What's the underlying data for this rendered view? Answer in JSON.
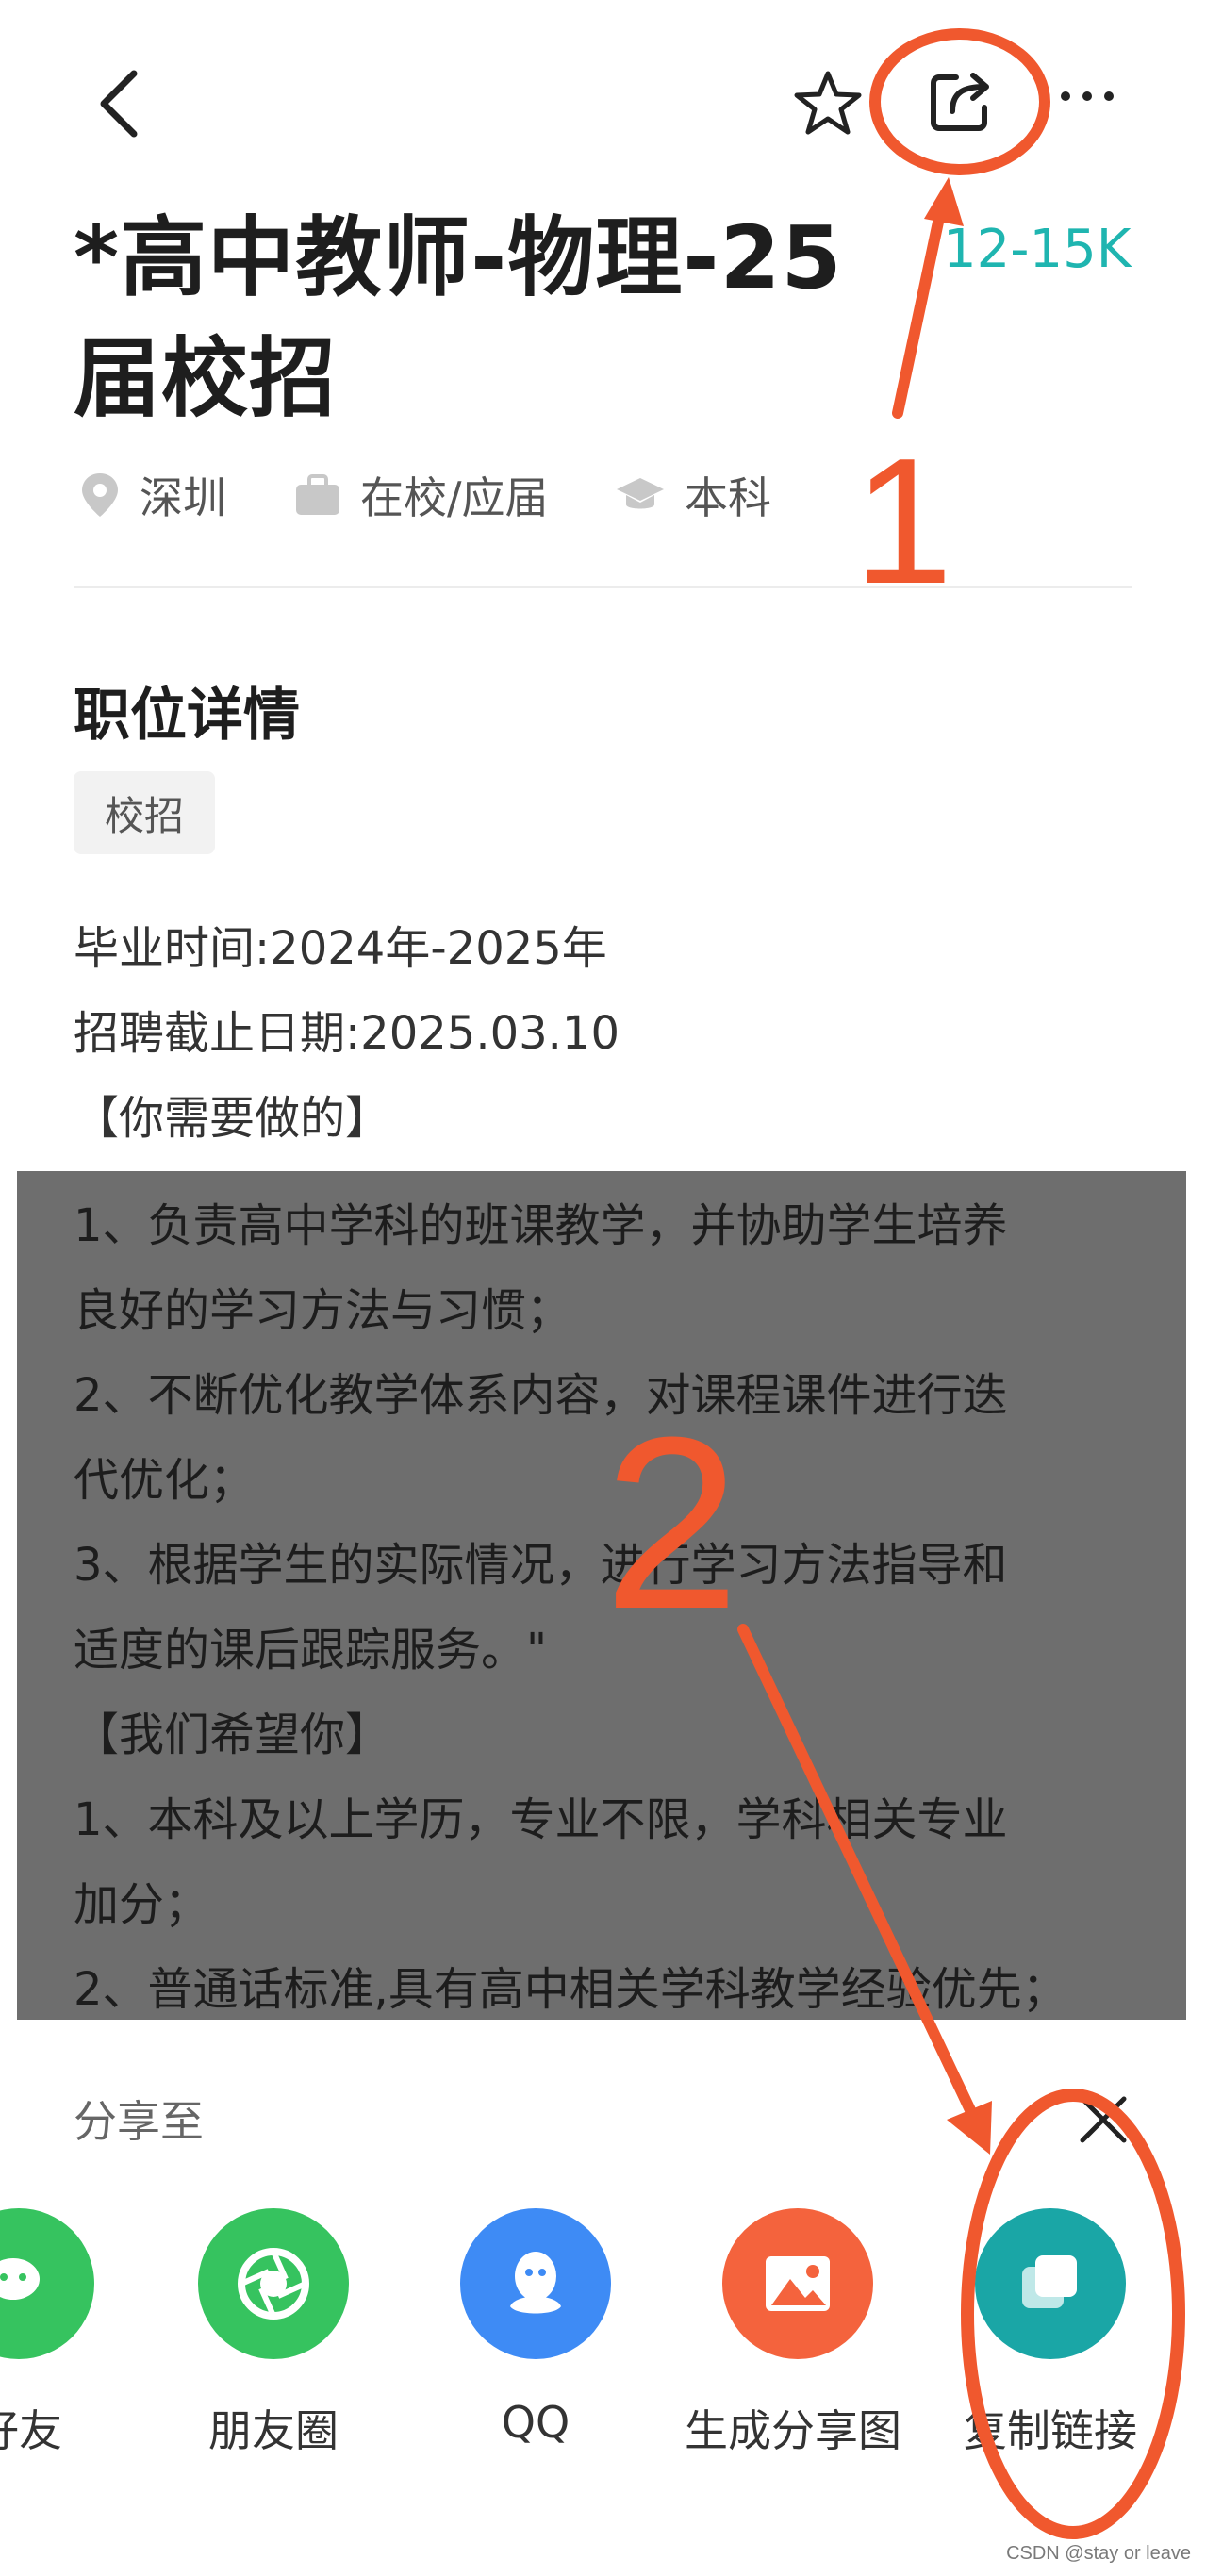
{
  "header": {
    "back_icon": "back-arrow-icon",
    "favorite_icon": "star-icon",
    "share_icon": "share-icon",
    "more_icon": "more-icon"
  },
  "job": {
    "title_line1": "*高中教师-物理-25",
    "title_line2": "届校招",
    "salary": "12-15K",
    "meta": [
      {
        "icon": "location-icon",
        "text": "深圳"
      },
      {
        "icon": "briefcase-icon",
        "text": "在校/应届"
      },
      {
        "icon": "graduation-cap-icon",
        "text": "本科"
      }
    ]
  },
  "details": {
    "section_title": "职位详情",
    "tag": "校招",
    "lines": [
      "毕业时间:2024年-2025年",
      "招聘截止日期:2025.03.10",
      "【你需要做的】"
    ],
    "overlay_lines": [
      "1、负责高中学科的班课教学，并协助学生培养",
      "良好的学习方法与习惯；",
      "2、不断优化教学体系内容，对课程课件进行迭",
      "代优化；",
      "3、根据学生的实际情况，进行学习方法指导和",
      "适度的课后跟踪服务。\"",
      "【我们希望你】",
      "1、本科及以上学历，专业不限，学科相关专业",
      "加分；",
      "2、普通话标准,具有高中相关学科教学经验优先；"
    ]
  },
  "share_sheet": {
    "label": "分享至",
    "close_icon": "close-icon",
    "items": [
      {
        "label": "好友",
        "icon": "wechat-icon",
        "color": "#36c35f"
      },
      {
        "label": "朋友圈",
        "icon": "moments-icon",
        "color": "#36c35f"
      },
      {
        "label": "QQ",
        "icon": "qq-icon",
        "color": "#3e8bf5"
      },
      {
        "label": "生成分享图",
        "icon": "image-icon",
        "color": "#f4633d"
      },
      {
        "label": "复制链接",
        "icon": "copy-link-icon",
        "color": "#1aa6a6"
      }
    ]
  },
  "annotations": {
    "step1": "1",
    "step2": "2",
    "color": "#f0582e"
  },
  "watermark": "CSDN @stay or leave"
}
